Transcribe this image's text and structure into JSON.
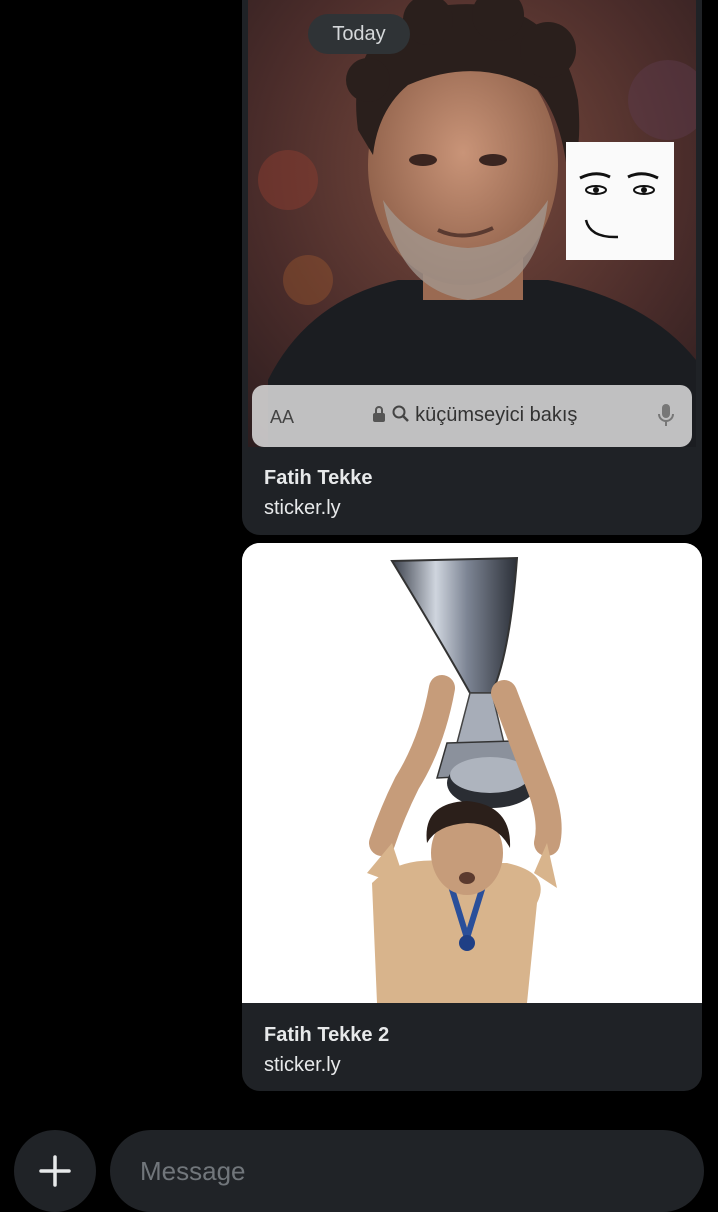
{
  "date_separator": "Today",
  "messages": [
    {
      "title": "Fatih Tekke",
      "domain": "sticker.ly",
      "image_search_bar": {
        "text_size_label": "AA",
        "query": "küçümseyici bakış"
      }
    },
    {
      "title": "Fatih Tekke 2",
      "domain": "sticker.ly"
    }
  ],
  "composer": {
    "placeholder": "Message"
  }
}
